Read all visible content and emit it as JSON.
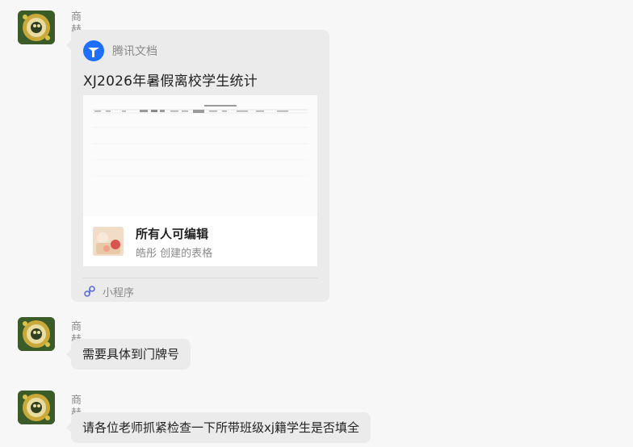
{
  "messages": [
    {
      "sender": "商赫",
      "card": {
        "source": "腾讯文档",
        "title": "XJ2026年暑假离校学生统计",
        "permission": "所有人可编辑",
        "creator": "皓彤 创建的表格",
        "footer": "小程序"
      }
    },
    {
      "sender": "商赫",
      "text": "需要具体到门牌号"
    },
    {
      "sender": "商赫",
      "text": "请各位老师抓紧检查一下所带班级xj籍学生是否填全"
    }
  ],
  "colors": {
    "bubble": "#ebebec",
    "background": "#f7f7f8",
    "tencent_docs_blue": "#1e6fff",
    "link_icon": "#5a6bd8"
  },
  "icons": {
    "avatar": "user-avatar-icon",
    "source": "tencent-docs-logo-icon",
    "footer": "mini-program-link-icon"
  }
}
